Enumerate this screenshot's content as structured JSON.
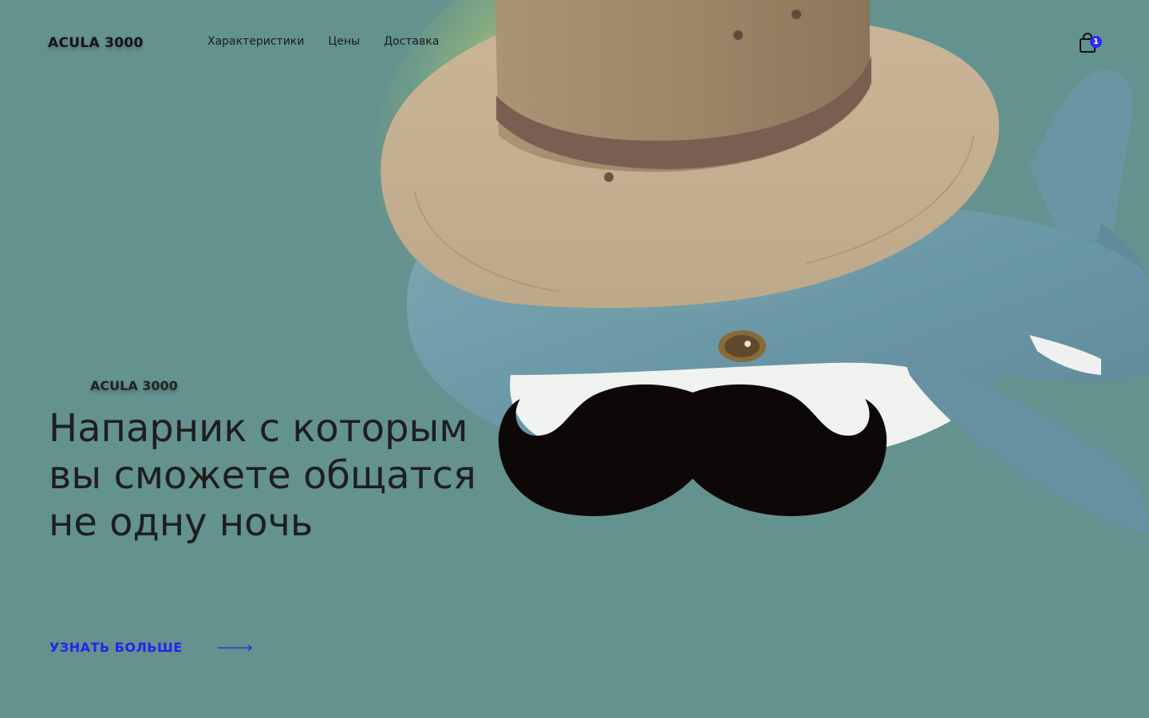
{
  "header": {
    "logo": "ACULA 3000",
    "nav": [
      {
        "label": "Характеристики"
      },
      {
        "label": "Цены"
      },
      {
        "label": "Доставка"
      }
    ],
    "cart": {
      "icon": "shopping-bag-icon",
      "count": "1"
    }
  },
  "hero": {
    "eyebrow": "ACULA 3000",
    "headline": "Напарник с которым вы сможете общатся не одну ночь",
    "cta": {
      "label": "УЗНАТЬ БОЛЬШЕ",
      "icon": "arrow-right-icon"
    },
    "image_icons": [
      "shark-plush-icon",
      "hat-icon",
      "mustache-icon"
    ]
  },
  "colors": {
    "background": "#64928e",
    "accent": "#2424ee",
    "text": "#1e1e1e"
  }
}
